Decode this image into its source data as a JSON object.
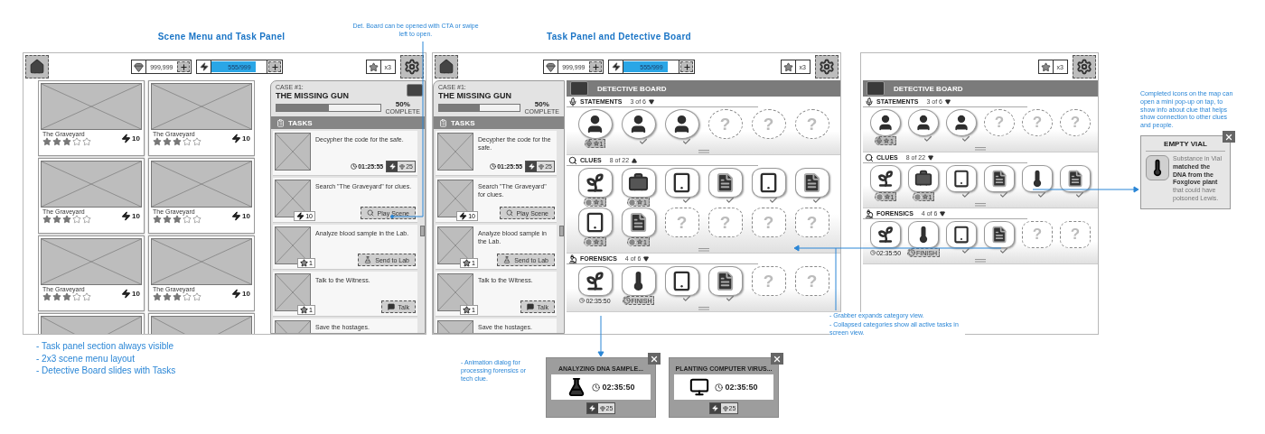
{
  "scene_menu": {
    "title": "Scene Menu and Task Panel",
    "header": {
      "items": [
        {
          "kind": "home"
        },
        {
          "kind": "gems",
          "value": "999,999"
        },
        {
          "kind": "energy",
          "value": "555/999",
          "level": 0.8
        },
        {
          "kind": "stars",
          "value": "x3"
        },
        {
          "kind": "settings"
        }
      ]
    },
    "scenes": [
      {
        "kind": "full",
        "name": "The Graveyard",
        "stars": 3,
        "energy": "10"
      },
      {
        "kind": "full",
        "name": "The Graveyard",
        "stars": 3,
        "energy": "10"
      },
      {
        "kind": "full",
        "name": "The Graveyard",
        "stars": 3,
        "energy": "10"
      },
      {
        "kind": "full",
        "name": "The Graveyard",
        "stars": 3,
        "energy": "10"
      },
      {
        "kind": "full",
        "name": "The Graveyard",
        "stars": 3,
        "energy": "10"
      },
      {
        "kind": "full",
        "name": "The Graveyard",
        "stars": 3,
        "energy": "10"
      },
      {
        "kind": "partial"
      },
      {
        "kind": "partial"
      }
    ],
    "task_panel": {
      "case_label": "CASE #1:",
      "case_title": "THE MISSING GUN",
      "progress": {
        "level": 0.5,
        "percent": "50%",
        "caption": "COMPLETE"
      },
      "tasks_title": "TASKS",
      "tasks": [
        {
          "kind": "timer",
          "text": "Decypher the code for the safe.",
          "time": "01:25:55",
          "cost": "25"
        },
        {
          "kind": "scene",
          "text": "Search \"The Graveyard\" for clues.",
          "button": "Play Scene",
          "reward": "10"
        },
        {
          "kind": "lab",
          "text": "Analyze blood sample in the Lab.",
          "button": "Send to Lab",
          "reward": "1"
        },
        {
          "kind": "talk",
          "text": "Talk to the Witness.",
          "button": "Talk",
          "reward": "1"
        },
        {
          "kind": "partial",
          "text": "Save the hostages."
        }
      ]
    },
    "notes": [
      "- Task panel section always visible",
      "- 2x3 scene menu layout",
      "- Detective Board slides with Tasks"
    ],
    "board_note": "Det. Board can be opened with CTA or swipe left to open."
  },
  "board_view": {
    "title": "Task Panel and Detective Board",
    "header": {
      "items": [
        {
          "kind": "home"
        },
        {
          "kind": "gems",
          "value": "999,999"
        },
        {
          "kind": "energy",
          "value": "555/999",
          "level": 0.8
        },
        {
          "kind": "stars",
          "value": "x3"
        },
        {
          "kind": "settings"
        }
      ]
    },
    "task_panel": {
      "case_label": "CASE #1:",
      "case_title": "THE MISSING GUN",
      "progress": {
        "level": 0.5,
        "percent": "50%",
        "caption": "COMPLETE"
      },
      "tasks_title": "TASKS",
      "tasks": [
        {
          "kind": "timer",
          "text": "Decypher the code for the safe.",
          "time": "01:25:55",
          "cost": "25"
        },
        {
          "kind": "scene",
          "text": "Search \"The Graveyard\" for clues.",
          "button": "Play Scene",
          "reward": "10"
        },
        {
          "kind": "lab",
          "text": "Analyze blood sample in the Lab.",
          "button": "Send to Lab",
          "reward": "1"
        },
        {
          "kind": "talk",
          "text": "Talk to the Witness.",
          "button": "Talk",
          "reward": "1"
        },
        {
          "kind": "partial",
          "text": "Save the hostages."
        }
      ]
    },
    "board": {
      "title": "DETECTIVE BOARD",
      "categories": [
        {
          "kind": "statements",
          "name": "STATEMENTS",
          "count": "3 of 6",
          "expanded": false,
          "items": [
            {
              "kind": "person",
              "done": false,
              "reward": "1"
            },
            {
              "kind": "person",
              "done": true
            },
            {
              "kind": "person",
              "done": true
            },
            {
              "kind": "unknown",
              "label": "?",
              "done": false
            },
            {
              "kind": "unknown",
              "label": "?",
              "done": false
            },
            {
              "kind": "unknown",
              "label": "?",
              "done": false
            }
          ]
        },
        {
          "kind": "clues",
          "name": "CLUES",
          "count": "8 of 22",
          "expanded": true,
          "items": [
            {
              "kind": "plant",
              "done": false,
              "reward": "1"
            },
            {
              "kind": "briefcase",
              "done": false,
              "reward": "1"
            },
            {
              "kind": "tablet",
              "done": true
            },
            {
              "kind": "document",
              "done": true
            },
            {
              "kind": "tablet",
              "done": true
            },
            {
              "kind": "document",
              "done": true
            },
            {
              "kind": "tablet",
              "done": false,
              "reward": "1"
            },
            {
              "kind": "document",
              "done": false,
              "reward": "1"
            },
            {
              "kind": "unknown",
              "label": "?",
              "done": false
            },
            {
              "kind": "unknown",
              "label": "?",
              "done": false
            },
            {
              "kind": "unknown",
              "label": "?",
              "done": false
            },
            {
              "kind": "unknown",
              "label": "?",
              "done": false
            }
          ]
        },
        {
          "kind": "forensics",
          "name": "FORENSICS",
          "count": "4 of 6",
          "expanded": false,
          "items": [
            {
              "kind": "plant",
              "done": false,
              "time": "02:35:50"
            },
            {
              "kind": "thermometer",
              "done": false,
              "button": "FINISH"
            },
            {
              "kind": "tablet",
              "done": true
            },
            {
              "kind": "document",
              "done": true
            },
            {
              "kind": "unknown",
              "label": "?",
              "done": false
            },
            {
              "kind": "unknown",
              "label": "?",
              "done": false
            }
          ]
        }
      ]
    },
    "grabber_notes": [
      "- Grabber expands category view.",
      "- Collapsed categories show all active tasks in screen view."
    ]
  },
  "board_only": {
    "header": {
      "items": [
        {
          "kind": "stars",
          "value": "x3"
        },
        {
          "kind": "settings"
        }
      ]
    },
    "board": {
      "title": "DETECTIVE BOARD",
      "categories": [
        {
          "kind": "statements",
          "name": "STATEMENTS",
          "count": "3 of 6",
          "expanded": false,
          "items": [
            {
              "kind": "person",
              "done": false,
              "reward": "1"
            },
            {
              "kind": "person",
              "done": true
            },
            {
              "kind": "person",
              "done": true
            },
            {
              "kind": "unknown",
              "label": "?",
              "done": false
            },
            {
              "kind": "unknown",
              "label": "?",
              "done": false
            },
            {
              "kind": "unknown",
              "label": "?",
              "done": false
            }
          ]
        },
        {
          "kind": "clues",
          "name": "CLUES",
          "count": "8 of 22",
          "expanded": false,
          "items": [
            {
              "kind": "plant",
              "done": false,
              "reward": "1"
            },
            {
              "kind": "briefcase",
              "done": false,
              "reward": "1"
            },
            {
              "kind": "tablet",
              "done": true
            },
            {
              "kind": "document",
              "done": true
            },
            {
              "kind": "thermometer",
              "done": true
            },
            {
              "kind": "document",
              "done": true
            }
          ]
        },
        {
          "kind": "forensics",
          "name": "FORENSICS",
          "count": "4 of 6",
          "expanded": false,
          "items": [
            {
              "kind": "plant",
              "done": false,
              "time": "02:35:50"
            },
            {
              "kind": "thermometer",
              "done": false,
              "button": "FINISH"
            },
            {
              "kind": "tablet",
              "done": true
            },
            {
              "kind": "document",
              "done": true
            },
            {
              "kind": "unknown",
              "label": "?",
              "done": false
            },
            {
              "kind": "unknown",
              "label": "?",
              "done": false
            }
          ]
        }
      ]
    }
  },
  "clue_popup": {
    "note": "Completed icons on the map can open a mini pop-up on tap, to show info about clue that helps show connection to other clues and people.",
    "title": "EMPTY VIAL",
    "body": "Substance in Vial **matched the DNA from the Foxglove plant** that could have poisoned Lewis."
  },
  "animation_dialogs": {
    "note": "- Animation dialog for processing forensics or tech clue.",
    "dialogs": [
      {
        "kind": "forensics",
        "title": "ANALYZING DNA SAMPLE...",
        "time": "02:35:50",
        "cost": "25"
      },
      {
        "kind": "tech",
        "title": "PLANTING COMPUTER VIRUS...",
        "time": "02:35:50",
        "cost": "25"
      }
    ]
  }
}
